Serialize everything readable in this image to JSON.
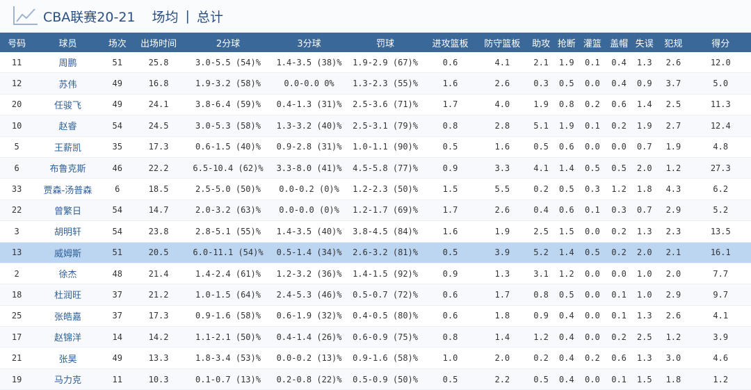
{
  "header": {
    "title": "CBA联赛20-21",
    "tabs": [
      "场均",
      "总计"
    ],
    "separator": "|",
    "active_tab": 0
  },
  "colors": {
    "header_bg": "#3a6898",
    "highlight_row": "#bcd6f2",
    "link": "#2f5f96"
  },
  "table": {
    "columns": [
      "号码",
      "球员",
      "场次",
      "出场时间",
      "2分球",
      "3分球",
      "罚球",
      "进攻篮板",
      "防守篮板",
      "助攻",
      "抢断",
      "灌篮",
      "盖帽",
      "失误",
      "犯规",
      "得分"
    ],
    "highlight_index": 9,
    "rows": [
      [
        "11",
        "周鹏",
        "51",
        "25.8",
        "3.0-5.5 (54)%",
        "1.4-3.5 (38)%",
        "1.9-2.9 (67)%",
        "0.6",
        "4.1",
        "2.1",
        "1.9",
        "0.1",
        "0.4",
        "1.3",
        "2.6",
        "12.0"
      ],
      [
        "12",
        "苏伟",
        "49",
        "16.8",
        "1.9-3.2 (58)%",
        "0.0-0.0 0%",
        "1.3-2.3 (55)%",
        "1.6",
        "2.6",
        "0.3",
        "0.5",
        "0.0",
        "0.4",
        "0.9",
        "3.7",
        "5.0"
      ],
      [
        "20",
        "任骏飞",
        "49",
        "24.1",
        "3.8-6.4 (59)%",
        "0.4-1.3 (31)%",
        "2.5-3.6 (71)%",
        "1.7",
        "4.0",
        "1.9",
        "0.8",
        "0.2",
        "0.6",
        "1.4",
        "2.5",
        "11.3"
      ],
      [
        "10",
        "赵睿",
        "54",
        "24.5",
        "3.0-5.3 (58)%",
        "1.3-3.2 (40)%",
        "2.5-3.1 (79)%",
        "0.8",
        "2.8",
        "5.1",
        "1.9",
        "0.1",
        "0.2",
        "1.9",
        "2.7",
        "12.4"
      ],
      [
        "5",
        "王薪凯",
        "35",
        "17.3",
        "0.6-1.5 (40)%",
        "0.9-2.8 (31)%",
        "1.0-1.1 (90)%",
        "0.5",
        "1.6",
        "0.5",
        "0.6",
        "0.0",
        "0.0",
        "0.7",
        "1.9",
        "4.8"
      ],
      [
        "6",
        "布鲁克斯",
        "46",
        "22.2",
        "6.5-10.4 (62)%",
        "3.3-8.0 (41)%",
        "4.5-5.8 (77)%",
        "0.9",
        "3.3",
        "4.1",
        "1.4",
        "0.5",
        "0.5",
        "2.0",
        "1.2",
        "27.3"
      ],
      [
        "33",
        "贾森-汤普森",
        "6",
        "18.5",
        "2.5-5.0 (50)%",
        "0.0-0.2 (0)%",
        "1.2-2.3 (50)%",
        "1.5",
        "5.5",
        "0.2",
        "0.5",
        "0.3",
        "1.2",
        "1.8",
        "4.3",
        "6.2"
      ],
      [
        "22",
        "曾繁日",
        "54",
        "14.7",
        "2.0-3.2 (63)%",
        "0.0-0.0 (0)%",
        "1.2-1.7 (69)%",
        "1.7",
        "2.6",
        "0.4",
        "0.6",
        "0.1",
        "0.3",
        "0.7",
        "2.9",
        "5.2"
      ],
      [
        "3",
        "胡明轩",
        "54",
        "23.8",
        "2.8-5.1 (55)%",
        "1.4-3.5 (40)%",
        "3.8-4.5 (84)%",
        "1.6",
        "1.9",
        "2.5",
        "1.5",
        "0.0",
        "0.2",
        "1.3",
        "2.3",
        "13.5"
      ],
      [
        "13",
        "威姆斯",
        "51",
        "20.5",
        "6.0-11.1 (54)%",
        "0.5-1.4 (34)%",
        "2.6-3.2 (81)%",
        "0.5",
        "3.9",
        "5.2",
        "1.4",
        "0.5",
        "0.2",
        "2.0",
        "2.1",
        "16.1"
      ],
      [
        "2",
        "徐杰",
        "48",
        "21.4",
        "1.4-2.4 (61)%",
        "1.2-3.2 (36)%",
        "1.4-1.5 (92)%",
        "0.9",
        "1.3",
        "3.1",
        "1.2",
        "0.0",
        "0.0",
        "1.0",
        "2.0",
        "7.7"
      ],
      [
        "18",
        "杜润旺",
        "37",
        "21.2",
        "1.0-1.5 (64)%",
        "2.4-5.3 (46)%",
        "0.5-0.7 (72)%",
        "0.6",
        "1.7",
        "0.8",
        "0.5",
        "0.0",
        "0.1",
        "1.0",
        "2.9",
        "9.7"
      ],
      [
        "25",
        "张皓嘉",
        "37",
        "17.3",
        "0.9-1.6 (58)%",
        "0.6-1.9 (32)%",
        "0.4-0.5 (80)%",
        "0.6",
        "1.8",
        "0.9",
        "0.4",
        "0.0",
        "0.1",
        "1.3",
        "2.6",
        "4.1"
      ],
      [
        "17",
        "赵锦洋",
        "14",
        "14.2",
        "1.1-2.1 (50)%",
        "0.4-1.4 (26)%",
        "0.6-0.9 (75)%",
        "0.8",
        "1.4",
        "1.2",
        "0.4",
        "0.0",
        "0.2",
        "2.5",
        "1.2",
        "3.9"
      ],
      [
        "21",
        "张昊",
        "49",
        "13.3",
        "1.8-3.4 (53)%",
        "0.0-0.2 (13)%",
        "0.9-1.6 (58)%",
        "1.0",
        "2.0",
        "0.2",
        "0.4",
        "0.2",
        "0.6",
        "1.3",
        "3.0",
        "4.6"
      ],
      [
        "19",
        "马力克",
        "11",
        "10.3",
        "0.1-0.7 (13)%",
        "0.2-0.8 (22)%",
        "0.5-0.9 (50)%",
        "0.5",
        "2.2",
        "0.5",
        "0.4",
        "0.0",
        "0.1",
        "1.5",
        "1.8",
        "1.2"
      ]
    ]
  }
}
